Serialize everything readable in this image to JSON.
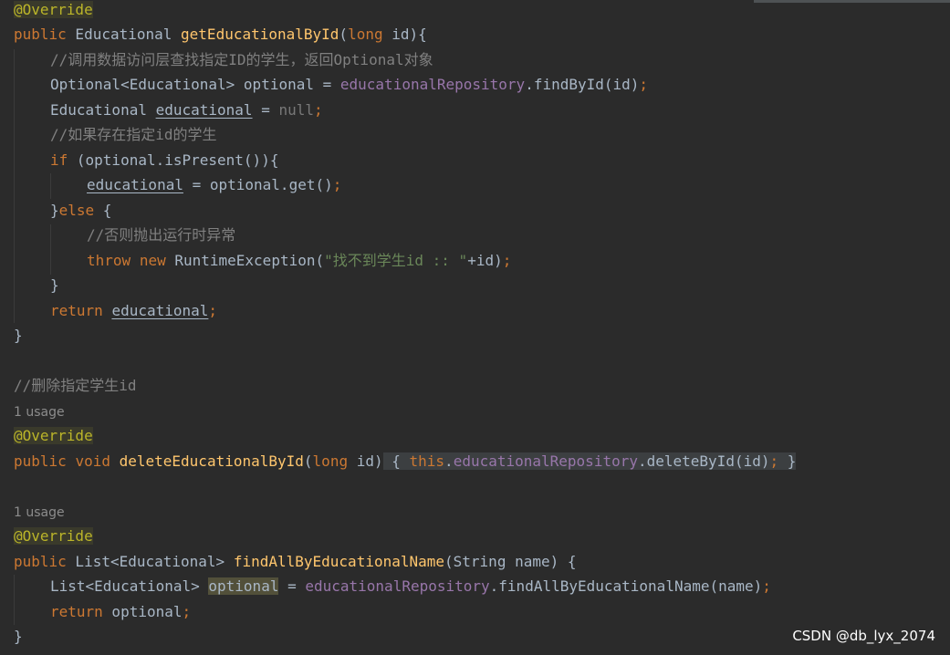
{
  "code": {
    "annotation": "@Override",
    "kw_public": "public",
    "kw_void": "void",
    "kw_long": "long",
    "kw_if": "if",
    "kw_else": "else",
    "kw_throw": "throw",
    "kw_new": "new",
    "kw_return": "return",
    "kw_this": "this",
    "kw_null": "null",
    "l2_type": " Educational ",
    "l2_fn": "getEducationalById",
    "l2_tail": " id){",
    "l3_comment": "//调用数据访问层查找指定ID的学生，返回Optional对象",
    "l4_a": "Optional<Educational> optional = ",
    "l4_repo": "educationalRepository",
    "l4_b": ".findById(id)",
    "l5_a": "Educational ",
    "l5_var": "educational",
    "l5_b": " = ",
    "l6_comment": "//如果存在指定id的学生",
    "l7_tail": " (optional.isPresent()){",
    "l8_var": "educational",
    "l8_b": " = optional.get()",
    "l9_close": "}",
    "l9_tail": " {",
    "l10_comment": "//否则抛出运行时异常",
    "l11_a": " RuntimeException(",
    "l11_str": "\"找不到学生id :: \"",
    "l11_b": "+id)",
    "l12": "}",
    "l13_var": "educational",
    "l14": "}",
    "l16_comment": "//删除指定学生id",
    "usage1": "1 usage",
    "l19_fn": "deleteEducationalById",
    "l19_args": " id)",
    "l19_open": " { ",
    "l19_repo": "educationalRepository",
    "l19_call": ".deleteById(id)",
    "l19_close": " }",
    "usage2": "1 usage",
    "l22_type": " List<Educational> ",
    "l22_fn": "findAllByEducationalName",
    "l22_tail": "(String name) {",
    "l23_a": "List<Educational> ",
    "l23_var": "optional",
    "l23_b": " = ",
    "l23_repo": "educationalRepository",
    "l23_call": ".findAllByEducationalName(name)",
    "l24_b": " optional",
    "l25": "}",
    "semi": ";",
    "dot": ".",
    "paren_open": "("
  },
  "watermark": "CSDN @db_lyx_2074"
}
